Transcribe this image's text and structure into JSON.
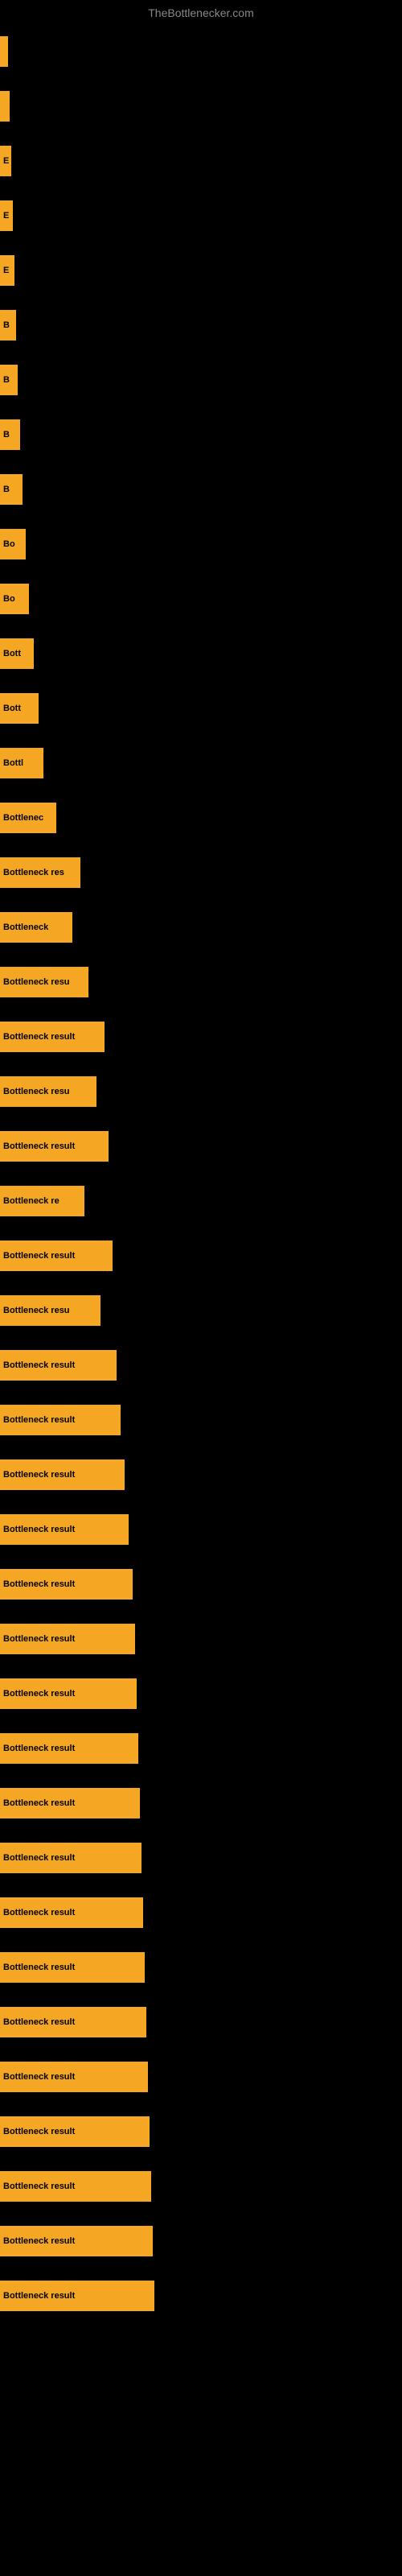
{
  "site_title": "TheBottlenecker.com",
  "bars": [
    {
      "label": "",
      "width": 10
    },
    {
      "label": "",
      "width": 12
    },
    {
      "label": "E",
      "width": 14
    },
    {
      "label": "E",
      "width": 16
    },
    {
      "label": "E",
      "width": 18
    },
    {
      "label": "B",
      "width": 20
    },
    {
      "label": "B",
      "width": 22
    },
    {
      "label": "B",
      "width": 25
    },
    {
      "label": "B",
      "width": 28
    },
    {
      "label": "Bo",
      "width": 32
    },
    {
      "label": "Bo",
      "width": 36
    },
    {
      "label": "Bott",
      "width": 42
    },
    {
      "label": "Bott",
      "width": 48
    },
    {
      "label": "Bottl",
      "width": 54
    },
    {
      "label": "Bottlenec",
      "width": 70
    },
    {
      "label": "Bottleneck res",
      "width": 100
    },
    {
      "label": "Bottleneck",
      "width": 90
    },
    {
      "label": "Bottleneck resu",
      "width": 110
    },
    {
      "label": "Bottleneck result",
      "width": 130
    },
    {
      "label": "Bottleneck resu",
      "width": 120
    },
    {
      "label": "Bottleneck result",
      "width": 135
    },
    {
      "label": "Bottleneck re",
      "width": 105
    },
    {
      "label": "Bottleneck result",
      "width": 140
    },
    {
      "label": "Bottleneck resu",
      "width": 125
    },
    {
      "label": "Bottleneck result",
      "width": 145
    },
    {
      "label": "Bottleneck result",
      "width": 150
    },
    {
      "label": "Bottleneck result",
      "width": 155
    },
    {
      "label": "Bottleneck result",
      "width": 160
    },
    {
      "label": "Bottleneck result",
      "width": 165
    },
    {
      "label": "Bottleneck result",
      "width": 168
    },
    {
      "label": "Bottleneck result",
      "width": 170
    },
    {
      "label": "Bottleneck result",
      "width": 172
    },
    {
      "label": "Bottleneck result",
      "width": 174
    },
    {
      "label": "Bottleneck result",
      "width": 176
    },
    {
      "label": "Bottleneck result",
      "width": 178
    },
    {
      "label": "Bottleneck result",
      "width": 180
    },
    {
      "label": "Bottleneck result",
      "width": 182
    },
    {
      "label": "Bottleneck result",
      "width": 184
    },
    {
      "label": "Bottleneck result",
      "width": 186
    },
    {
      "label": "Bottleneck result",
      "width": 188
    },
    {
      "label": "Bottleneck result",
      "width": 190
    },
    {
      "label": "Bottleneck result",
      "width": 192
    }
  ]
}
